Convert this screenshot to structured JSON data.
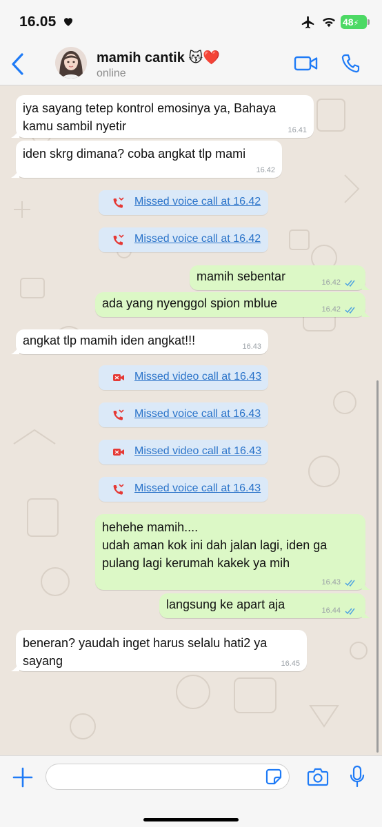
{
  "status_bar": {
    "time": "16.05",
    "battery": "48"
  },
  "header": {
    "contact_name": "mamih cantik",
    "contact_emoji": "😽❤️",
    "status": "online"
  },
  "messages": [
    {
      "direction": "in",
      "text": "iya sayang tetep kontrol emosinya ya, Bahaya\nkamu sambil nyetir",
      "time": "16.41"
    },
    {
      "direction": "in",
      "text": "iden skrg dimana? coba angkat tlp mami",
      "time": "16.42"
    },
    {
      "type": "missed",
      "kind": "voice",
      "label": "Missed voice call at 16.42"
    },
    {
      "type": "missed",
      "kind": "voice",
      "label": "Missed voice call at 16.42"
    },
    {
      "direction": "out",
      "text": "mamih sebentar",
      "time": "16.42",
      "read": true
    },
    {
      "direction": "out",
      "text": "ada yang nyenggol spion mblue",
      "time": "16.42",
      "read": true
    },
    {
      "direction": "in",
      "text": "angkat tlp mamih iden angkat!!!",
      "time": "16.43"
    },
    {
      "type": "missed",
      "kind": "video",
      "label": "Missed video call at 16.43"
    },
    {
      "type": "missed",
      "kind": "voice",
      "label": "Missed voice call at 16.43"
    },
    {
      "type": "missed",
      "kind": "video",
      "label": "Missed video call at 16.43"
    },
    {
      "type": "missed",
      "kind": "voice",
      "label": "Missed voice call at 16.43"
    },
    {
      "direction": "out",
      "text": "hehehe mamih....\nudah aman kok ini dah jalan lagi, iden ga\npulang lagi kerumah kakek ya mih",
      "time": "16.43",
      "read": true
    },
    {
      "direction": "out",
      "text": "langsung ke apart aja",
      "time": "16.44",
      "read": true
    },
    {
      "direction": "in",
      "text": "beneran? yaudah inget harus selalu hati2 ya\nsayang",
      "time": "16.45"
    }
  ],
  "input": {
    "placeholder": "",
    "value": ""
  },
  "icons": {
    "back": "chevron-left-icon",
    "video_call": "video-camera-icon",
    "phone": "phone-icon",
    "plus": "plus-icon",
    "sticker": "sticker-icon",
    "camera": "camera-icon",
    "mic": "microphone-icon",
    "missed_voice": "missed-voice-call-icon",
    "missed_video": "missed-video-call-icon"
  },
  "colors": {
    "accent": "#1f7bf6",
    "incoming_bubble": "#ffffff",
    "outgoing_bubble": "#dcf8c6",
    "missed_call_bubble": "#dbe9f8",
    "missed_call_text": "#2a73c9",
    "missed_icon": "#e53935",
    "read_ticks": "#4fa3e0",
    "wallpaper": "#ece5dd"
  }
}
